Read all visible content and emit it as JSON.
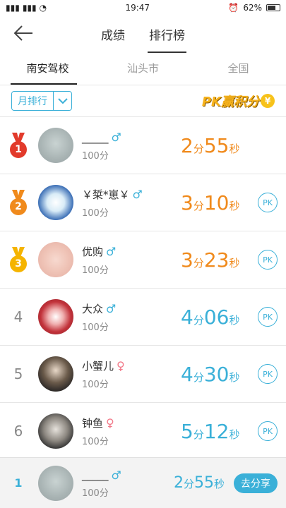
{
  "status_bar": {
    "time": "19:47",
    "battery": "62%"
  },
  "header": {
    "tabs": [
      {
        "label": "成绩"
      },
      {
        "label": "排行榜"
      }
    ]
  },
  "sub_tabs": [
    {
      "label": "南安驾校"
    },
    {
      "label": "汕头市"
    },
    {
      "label": "全国"
    }
  ],
  "filter": {
    "label": "月排行",
    "pk_logo": "PK赢积分",
    "yen": "¥"
  },
  "rows": [
    {
      "rank": "1",
      "name": "_____",
      "gender": "♂",
      "score": "100分",
      "min": "2",
      "min_unit": "分",
      "sec": "55",
      "sec_unit": "秒",
      "pk": ""
    },
    {
      "rank": "2",
      "name": "￥椞*崽￥",
      "gender": "♂",
      "score": "100分",
      "min": "3",
      "min_unit": "分",
      "sec": "10",
      "sec_unit": "秒",
      "pk": "PK"
    },
    {
      "rank": "3",
      "name": "优购",
      "gender": "♂",
      "score": "100分",
      "min": "3",
      "min_unit": "分",
      "sec": "23",
      "sec_unit": "秒",
      "pk": "PK"
    },
    {
      "rank": "4",
      "name": "大众",
      "gender": "♂",
      "score": "100分",
      "min": "4",
      "min_unit": "分",
      "sec": "06",
      "sec_unit": "秒",
      "pk": "PK"
    },
    {
      "rank": "5",
      "name": "小蟹儿",
      "gender": "♀",
      "score": "100分",
      "min": "4",
      "min_unit": "分",
      "sec": "30",
      "sec_unit": "秒",
      "pk": "PK"
    },
    {
      "rank": "6",
      "name": "钟鱼",
      "gender": "♀",
      "score": "100分",
      "min": "5",
      "min_unit": "分",
      "sec": "12",
      "sec_unit": "秒",
      "pk": "PK"
    }
  ],
  "bottom": {
    "rank": "1",
    "name": "_____",
    "gender": "♂",
    "score": "100分",
    "time_min": "2",
    "time_min_unit": "分",
    "time_sec": "55",
    "time_sec_unit": "秒",
    "share_label": "去分享"
  },
  "colors": {
    "accent": "#3ab0d8",
    "gold": "#f6a21c",
    "red_medal": "#e23a2b",
    "orange_medal": "#f08a1c",
    "yellow_medal": "#f5b400",
    "time_orange": "#f08a1c",
    "time_blue": "#3ab0d8"
  }
}
